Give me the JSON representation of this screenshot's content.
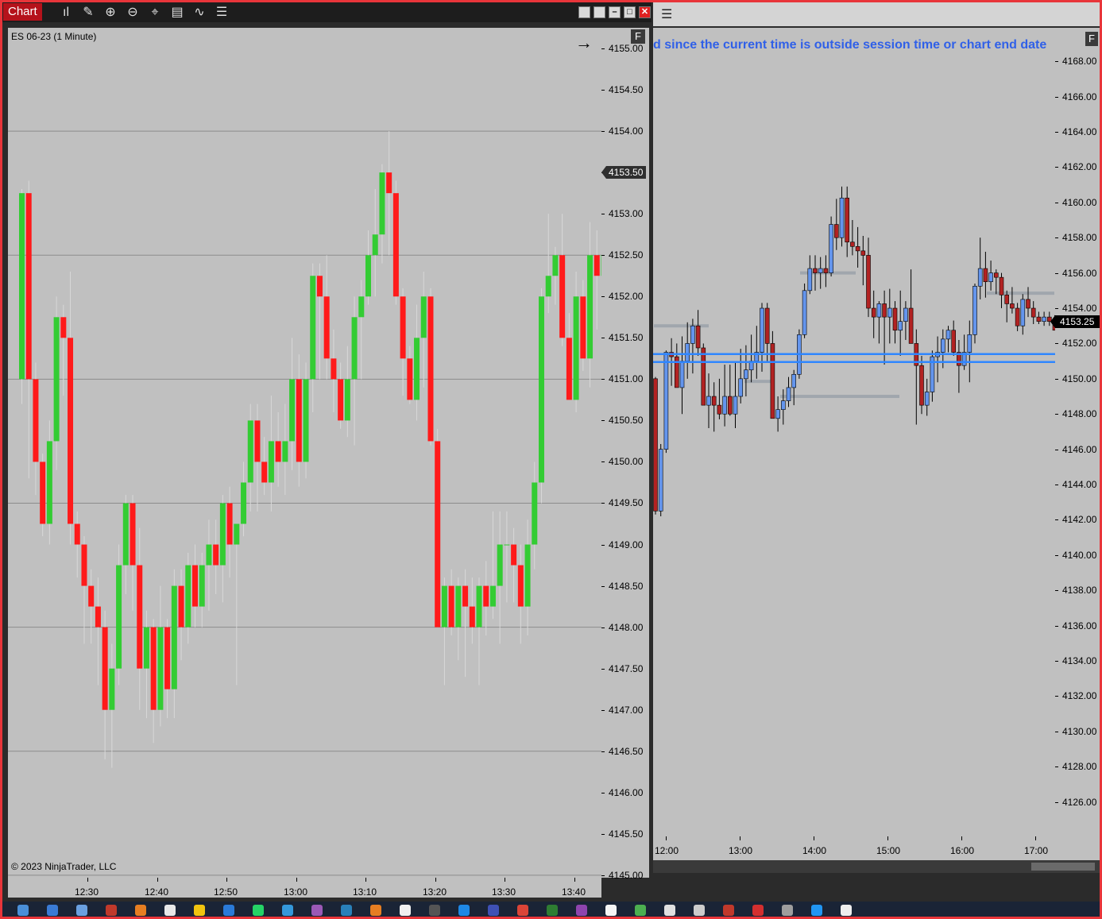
{
  "toolbar": {
    "title": "Chart",
    "tools": [
      {
        "icon": "bar-type-icon",
        "glyph": "ıl"
      },
      {
        "icon": "pencil-icon",
        "glyph": "✎"
      },
      {
        "icon": "zoom-in-icon",
        "glyph": "⊕"
      },
      {
        "icon": "zoom-out-icon",
        "glyph": "⊖"
      },
      {
        "icon": "crosshair-icon",
        "glyph": "⌖"
      },
      {
        "icon": "data-box-icon",
        "glyph": "▤"
      },
      {
        "icon": "indicator-icon",
        "glyph": "∿"
      },
      {
        "icon": "list-icon",
        "glyph": "☰"
      }
    ],
    "window_buttons": [
      {
        "icon": "restore-icon",
        "glyph": ""
      },
      {
        "icon": "tile-icon",
        "glyph": ""
      },
      {
        "icon": "minimize-icon",
        "glyph": "–"
      },
      {
        "icon": "maximize-icon",
        "glyph": "□"
      },
      {
        "icon": "close-icon",
        "glyph": "✕"
      }
    ]
  },
  "left_chart": {
    "instrument_label": "ES 06-23 (1 Minute)",
    "copyright": "© 2023 NinjaTrader, LLC",
    "arrow_glyph": "→",
    "f_label": "F",
    "last_price_label": "4153.50",
    "colors": {
      "up": "#33cc33",
      "down": "#ff1a1a",
      "wick": "#d8d8d8",
      "background": "#c0c0c0"
    }
  },
  "right_chart": {
    "message": "d since the current time is outside session time or chart end date",
    "f_label": "F",
    "last_price_label": "4153.25",
    "colors": {
      "up": "#6495ed",
      "down": "#b22222",
      "band": "#2f86ff",
      "background": "#c0c0c0"
    }
  },
  "chart_data": [
    {
      "type": "candlestick",
      "title": "ES 06-23 (1 Minute)",
      "y_ticks": [
        "4155.00",
        "4154.50",
        "4154.00",
        "4153.50",
        "4153.00",
        "4152.50",
        "4152.00",
        "4151.50",
        "4151.00",
        "4150.50",
        "4150.00",
        "4149.50",
        "4149.00",
        "4148.50",
        "4148.00",
        "4147.50",
        "4147.00",
        "4146.50",
        "4146.00",
        "4145.50",
        "4145.00"
      ],
      "x_ticks": [
        "12:30",
        "12:40",
        "12:50",
        "13:00",
        "13:10",
        "13:20",
        "13:30",
        "13:40"
      ],
      "ylim": [
        4144.97,
        4155.25
      ],
      "last_price": 4153.5,
      "candles_ohlc": [
        [
          4151.0,
          4153.3,
          4150.7,
          4153.25
        ],
        [
          4153.25,
          4153.4,
          4149.8,
          4151.0
        ],
        [
          4151.0,
          4151.2,
          4149.6,
          4150.0
        ],
        [
          4150.0,
          4150.1,
          4149.1,
          4149.25
        ],
        [
          4149.25,
          4150.5,
          4149.0,
          4150.25
        ],
        [
          4150.25,
          4152.0,
          4149.9,
          4151.75
        ],
        [
          4151.75,
          4151.9,
          4150.8,
          4151.5
        ],
        [
          4151.5,
          4152.3,
          4149.0,
          4149.25
        ],
        [
          4149.25,
          4149.4,
          4148.6,
          4149.0
        ],
        [
          4149.0,
          4149.1,
          4147.8,
          4148.5
        ],
        [
          4148.5,
          4148.7,
          4147.8,
          4148.25
        ],
        [
          4148.25,
          4148.6,
          4147.3,
          4148.0
        ],
        [
          4148.0,
          4148.2,
          4146.4,
          4147.0
        ],
        [
          4147.0,
          4147.8,
          4146.3,
          4147.5
        ],
        [
          4147.5,
          4149.0,
          4147.3,
          4148.75
        ],
        [
          4148.75,
          4149.6,
          4148.4,
          4149.5
        ],
        [
          4149.5,
          4149.6,
          4148.2,
          4148.75
        ],
        [
          4148.75,
          4149.2,
          4147.0,
          4147.5
        ],
        [
          4147.5,
          4148.2,
          4146.9,
          4148.0
        ],
        [
          4148.0,
          4148.1,
          4146.6,
          4147.0
        ],
        [
          4147.0,
          4148.5,
          4146.8,
          4148.0
        ],
        [
          4148.0,
          4148.1,
          4146.9,
          4147.25
        ],
        [
          4147.25,
          4148.7,
          4146.9,
          4148.5
        ],
        [
          4148.5,
          4148.7,
          4147.6,
          4148.0
        ],
        [
          4148.0,
          4148.9,
          4147.8,
          4148.75
        ],
        [
          4148.75,
          4149.0,
          4148.0,
          4148.25
        ],
        [
          4148.25,
          4148.9,
          4148.0,
          4148.75
        ],
        [
          4148.75,
          4149.3,
          4148.2,
          4149.0
        ],
        [
          4149.0,
          4149.3,
          4148.4,
          4148.75
        ],
        [
          4148.75,
          4149.6,
          4148.3,
          4149.5
        ],
        [
          4149.5,
          4149.7,
          4148.6,
          4149.0
        ],
        [
          4149.0,
          4149.2,
          4147.3,
          4149.25
        ],
        [
          4149.25,
          4150.0,
          4149.1,
          4149.75
        ],
        [
          4149.75,
          4150.7,
          4149.4,
          4150.5
        ],
        [
          4150.5,
          4150.7,
          4149.4,
          4150.0
        ],
        [
          4150.0,
          4150.3,
          4149.6,
          4149.75
        ],
        [
          4149.75,
          4150.8,
          4149.4,
          4150.25
        ],
        [
          4150.25,
          4150.6,
          4149.7,
          4150.0
        ],
        [
          4150.0,
          4150.7,
          4149.6,
          4150.25
        ],
        [
          4150.25,
          4151.5,
          4149.9,
          4151.0
        ],
        [
          4151.0,
          4151.3,
          4149.7,
          4150.0
        ],
        [
          4150.0,
          4151.2,
          4149.8,
          4151.0
        ],
        [
          4151.0,
          4152.4,
          4150.6,
          4152.25
        ],
        [
          4152.25,
          4152.4,
          4151.0,
          4152.0
        ],
        [
          4152.0,
          4152.5,
          4151.0,
          4151.25
        ],
        [
          4151.25,
          4151.6,
          4150.6,
          4151.0
        ],
        [
          4151.0,
          4151.2,
          4150.4,
          4150.5
        ],
        [
          4150.5,
          4151.4,
          4150.3,
          4151.0
        ],
        [
          4151.0,
          4152.0,
          4150.2,
          4151.75
        ],
        [
          4151.75,
          4152.2,
          4151.0,
          4152.0
        ],
        [
          4152.0,
          4152.8,
          4151.9,
          4152.5
        ],
        [
          4152.5,
          4153.3,
          4152.0,
          4152.75
        ],
        [
          4152.75,
          4153.6,
          4152.4,
          4153.5
        ],
        [
          4153.5,
          4154.0,
          4152.5,
          4153.25
        ],
        [
          4153.25,
          4153.4,
          4151.9,
          4152.0
        ],
        [
          4152.0,
          4152.1,
          4150.8,
          4151.25
        ],
        [
          4151.25,
          4151.4,
          4150.7,
          4150.75
        ],
        [
          4150.75,
          4151.9,
          4150.5,
          4151.5
        ],
        [
          4151.5,
          4152.3,
          4150.9,
          4152.0
        ],
        [
          4152.0,
          4152.1,
          4150.2,
          4150.25
        ],
        [
          4150.25,
          4150.4,
          4148.0,
          4148.0
        ],
        [
          4148.0,
          4148.6,
          4147.3,
          4148.5
        ],
        [
          4148.5,
          4148.7,
          4147.9,
          4148.0
        ],
        [
          4148.0,
          4148.6,
          4147.6,
          4148.5
        ],
        [
          4148.5,
          4148.7,
          4147.4,
          4148.25
        ],
        [
          4148.25,
          4148.6,
          4147.8,
          4148.0
        ],
        [
          4148.0,
          4148.6,
          4147.3,
          4148.5
        ],
        [
          4148.5,
          4148.8,
          4147.9,
          4148.25
        ],
        [
          4148.25,
          4149.4,
          4148.1,
          4148.5
        ],
        [
          4148.5,
          4149.4,
          4147.8,
          4149.0
        ],
        [
          4149.0,
          4149.4,
          4148.3,
          4149.0
        ],
        [
          4149.0,
          4149.2,
          4148.3,
          4148.75
        ],
        [
          4148.75,
          4149.0,
          4147.8,
          4148.25
        ],
        [
          4148.25,
          4149.3,
          4147.9,
          4149.0
        ],
        [
          4149.0,
          4150.0,
          4148.7,
          4149.75
        ],
        [
          4149.75,
          4152.1,
          4149.5,
          4152.0
        ],
        [
          4152.0,
          4153.0,
          4151.8,
          4152.25
        ],
        [
          4152.25,
          4152.6,
          4151.9,
          4152.5
        ],
        [
          4152.5,
          4153.0,
          4151.4,
          4151.5
        ],
        [
          4151.5,
          4151.8,
          4150.8,
          4150.75
        ],
        [
          4150.75,
          4152.3,
          4150.6,
          4152.0
        ],
        [
          4152.0,
          4152.2,
          4151.1,
          4151.25
        ],
        [
          4151.25,
          4152.9,
          4150.9,
          4152.5
        ],
        [
          4152.5,
          4152.8,
          4151.6,
          4152.25
        ],
        [
          4152.25,
          4152.7,
          4151.9,
          4152.5
        ],
        [
          4152.5,
          4152.8,
          4152.3,
          4152.75
        ],
        [
          4152.75,
          4154.0,
          4152.5,
          4153.5
        ]
      ]
    },
    {
      "type": "candlestick",
      "y_ticks": [
        "4168.00",
        "4166.00",
        "4164.00",
        "4162.00",
        "4160.00",
        "4158.00",
        "4156.00",
        "4154.00",
        "4152.00",
        "4150.00",
        "4148.00",
        "4146.00",
        "4144.00",
        "4142.00",
        "4140.00",
        "4138.00",
        "4136.00",
        "4134.00",
        "4132.00",
        "4130.00",
        "4128.00",
        "4126.00"
      ],
      "x_ticks": [
        "12:00",
        "13:00",
        "14:00",
        "15:00",
        "16:00",
        "17:00"
      ],
      "ylim": [
        4124.05,
        4169.9
      ],
      "last_price": 4153.25,
      "horizontal_lines": [
        4151.4,
        4150.95
      ],
      "candles_ohlc": [
        [
          4150.0,
          4150.1,
          4142.3,
          4142.5
        ],
        [
          4142.5,
          4146.3,
          4142.2,
          4146.0
        ],
        [
          4146.0,
          4151.6,
          4145.8,
          4151.5
        ],
        [
          4151.5,
          4152.3,
          4149.6,
          4151.25
        ],
        [
          4151.25,
          4152.0,
          4149.7,
          4149.5
        ],
        [
          4149.5,
          4152.4,
          4148.0,
          4151.0
        ],
        [
          4151.0,
          4153.2,
          4150.0,
          4152.0
        ],
        [
          4152.0,
          4153.4,
          4150.3,
          4153.0
        ],
        [
          4153.0,
          4153.9,
          4151.3,
          4151.75
        ],
        [
          4151.75,
          4152.0,
          4148.8,
          4148.5
        ],
        [
          4148.5,
          4150.3,
          4147.2,
          4149.0
        ],
        [
          4149.0,
          4149.8,
          4147.0,
          4148.5
        ],
        [
          4148.5,
          4150.0,
          4147.7,
          4148.0
        ],
        [
          4148.0,
          4150.8,
          4147.3,
          4149.0
        ],
        [
          4149.0,
          4150.8,
          4147.9,
          4148.0
        ],
        [
          4148.0,
          4151.0,
          4147.2,
          4149.0
        ],
        [
          4149.0,
          4151.7,
          4148.6,
          4150.0
        ],
        [
          4150.0,
          4151.9,
          4149.0,
          4150.5
        ],
        [
          4150.5,
          4152.5,
          4149.8,
          4151.0
        ],
        [
          4151.0,
          4153.0,
          4150.0,
          4151.5
        ],
        [
          4151.5,
          4154.3,
          4150.4,
          4154.0
        ],
        [
          4154.0,
          4154.3,
          4151.0,
          4152.0
        ],
        [
          4152.0,
          4152.7,
          4148.0,
          4147.75
        ],
        [
          4147.75,
          4149.0,
          4147.0,
          4148.25
        ],
        [
          4148.25,
          4149.4,
          4147.4,
          4148.75
        ],
        [
          4148.75,
          4150.1,
          4148.4,
          4149.5
        ],
        [
          4149.5,
          4150.5,
          4148.5,
          4150.25
        ],
        [
          4150.25,
          4152.8,
          4150.0,
          4152.5
        ],
        [
          4152.5,
          4155.4,
          4152.3,
          4155.0
        ],
        [
          4155.0,
          4157.0,
          4154.8,
          4156.25
        ],
        [
          4156.25,
          4157.0,
          4155.0,
          4156.0
        ],
        [
          4156.0,
          4156.9,
          4155.1,
          4156.25
        ],
        [
          4156.25,
          4157.0,
          4155.2,
          4156.0
        ],
        [
          4156.0,
          4159.2,
          4155.8,
          4158.75
        ],
        [
          4158.75,
          4160.2,
          4157.3,
          4158.0
        ],
        [
          4158.0,
          4160.9,
          4157.5,
          4160.25
        ],
        [
          4160.25,
          4160.9,
          4156.9,
          4157.75
        ],
        [
          4157.75,
          4159.0,
          4157.0,
          4157.5
        ],
        [
          4157.5,
          4158.6,
          4156.3,
          4157.25
        ],
        [
          4157.25,
          4158.1,
          4155.3,
          4157.0
        ],
        [
          4157.0,
          4158.0,
          4153.5,
          4154.0
        ],
        [
          4154.0,
          4155.0,
          4152.3,
          4153.5
        ],
        [
          4153.5,
          4154.4,
          4152.0,
          4154.25
        ],
        [
          4154.25,
          4155.0,
          4150.8,
          4153.5
        ],
        [
          4153.5,
          4155.1,
          4152.0,
          4154.0
        ],
        [
          4154.0,
          4154.4,
          4152.0,
          4152.75
        ],
        [
          4152.75,
          4155.0,
          4151.3,
          4153.25
        ],
        [
          4153.25,
          4154.4,
          4152.2,
          4154.0
        ],
        [
          4154.0,
          4156.2,
          4152.0,
          4152.0
        ],
        [
          4152.0,
          4152.8,
          4147.4,
          4150.75
        ],
        [
          4150.75,
          4151.3,
          4148.0,
          4148.5
        ],
        [
          4148.5,
          4150.0,
          4147.9,
          4149.25
        ],
        [
          4149.25,
          4151.6,
          4148.7,
          4151.25
        ],
        [
          4151.25,
          4152.4,
          4149.8,
          4151.5
        ],
        [
          4151.5,
          4152.8,
          4150.6,
          4152.25
        ],
        [
          4152.25,
          4153.0,
          4151.5,
          4152.75
        ],
        [
          4152.75,
          4153.3,
          4151.3,
          4151.5
        ],
        [
          4151.5,
          4152.2,
          4149.2,
          4150.75
        ],
        [
          4150.75,
          4152.5,
          4150.5,
          4151.5
        ],
        [
          4151.5,
          4153.3,
          4149.8,
          4152.5
        ],
        [
          4152.5,
          4155.4,
          4152.0,
          4155.25
        ],
        [
          4155.25,
          4158.0,
          4154.5,
          4156.25
        ],
        [
          4156.25,
          4157.2,
          4154.6,
          4155.5
        ],
        [
          4155.5,
          4156.7,
          4155.0,
          4156.0
        ],
        [
          4156.0,
          4156.2,
          4154.8,
          4155.75
        ],
        [
          4155.75,
          4156.0,
          4154.0,
          4154.75
        ],
        [
          4154.75,
          4155.0,
          4153.2,
          4154.25
        ],
        [
          4154.25,
          4155.2,
          4153.7,
          4154.0
        ],
        [
          4154.0,
          4154.3,
          4152.7,
          4153.0
        ],
        [
          4153.0,
          4154.8,
          4152.5,
          4154.5
        ],
        [
          4154.5,
          4155.2,
          4153.5,
          4154.0
        ],
        [
          4154.0,
          4154.4,
          4153.1,
          4153.5
        ],
        [
          4153.5,
          4153.8,
          4153.1,
          4153.25
        ],
        [
          4153.25,
          4153.8,
          4153.0,
          4153.5
        ],
        [
          4153.5,
          4153.8,
          4153.0,
          4153.25
        ],
        [
          4153.25,
          4153.6,
          4152.9,
          4152.75
        ]
      ]
    }
  ]
}
